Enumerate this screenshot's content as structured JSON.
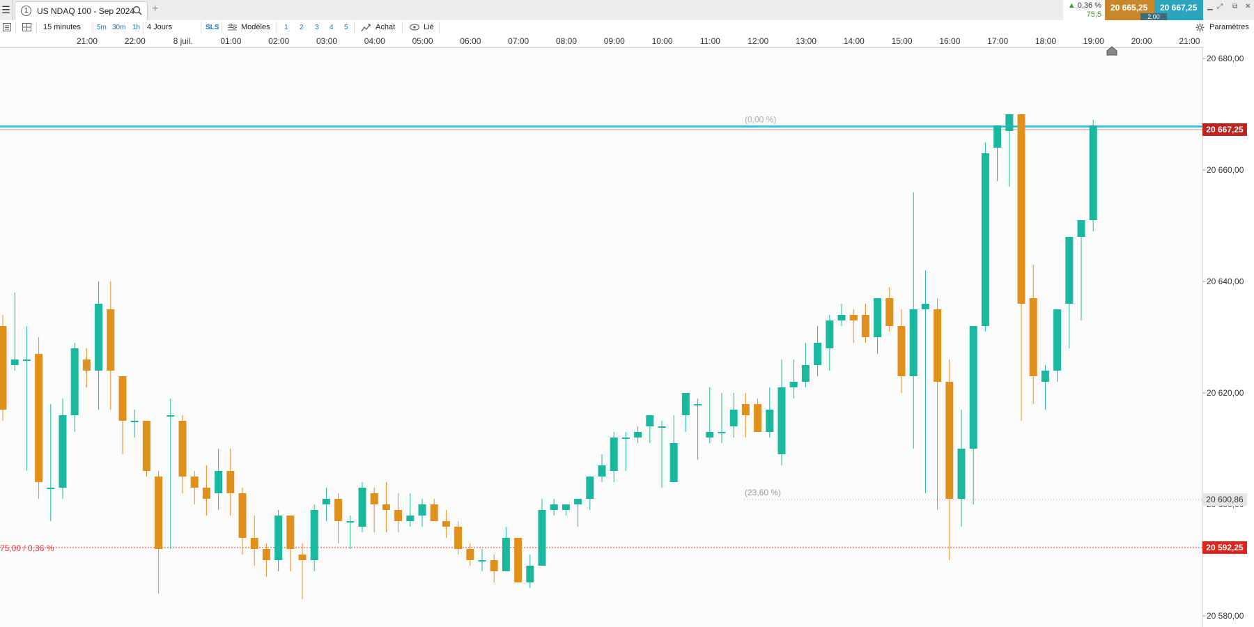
{
  "header": {
    "tab_number": "1",
    "tab_title": "US NDAQ 100 - Sep 2024",
    "change_pct": "0,36 %",
    "change_pts": "75,5",
    "bid": "20 665,25",
    "ask": "20 667,25",
    "spread": "2,00"
  },
  "toolbar": {
    "interval": "15 minutes",
    "btn_5m": "5m",
    "btn_30m": "30m",
    "btn_1h": "1h",
    "range": "4 Jours",
    "sls": "SLS",
    "models": "Modèles",
    "presets": [
      "1",
      "2",
      "3",
      "4",
      "5"
    ],
    "buy": "Achat",
    "linked": "Lié",
    "settings": "Paramètres"
  },
  "colors": {
    "bull": "#1bb8a0",
    "bear": "#e0911d",
    "price_line": "#2ec4e6",
    "last_price_bg": "#c0221d",
    "ref_line": "#e23b3b"
  },
  "chart_data": {
    "type": "candlestick",
    "instrument": "US NDAQ 100 - Sep 2024",
    "interval": "15 minutes",
    "x_ticks": [
      "21:00",
      "22:00",
      "8 juil.",
      "01:00",
      "02:00",
      "03:00",
      "04:00",
      "05:00",
      "06:00",
      "07:00",
      "08:00",
      "09:00",
      "10:00",
      "11:00",
      "12:00",
      "13:00",
      "14:00",
      "15:00",
      "16:00",
      "17:00",
      "18:00",
      "19:00",
      "20:00",
      "21:00"
    ],
    "y_ticks": [
      "20 580,00",
      "20 600,00",
      "20 620,00",
      "20 640,00",
      "20 660,00",
      "20 680,00"
    ],
    "ylim": [
      20578,
      20682
    ],
    "price_axis_position": "right",
    "last_price": "20 667,25",
    "reference_price": "20 592,25",
    "reference_label": "75,00 / 0,36 %",
    "fib_levels": [
      {
        "label": "(0,00 %)",
        "value": 20667.8
      },
      {
        "label": "(23,60 %)",
        "value": 20600.86,
        "value_label": "20 600,86"
      }
    ],
    "candles": [
      [
        20632,
        20634,
        20615,
        20617
      ],
      [
        20625,
        20638,
        20624,
        20626
      ],
      [
        20626,
        20632,
        20606,
        20626
      ],
      [
        20627,
        20630,
        20601,
        20604
      ],
      [
        20603,
        20618,
        20597,
        20603
      ],
      [
        20603,
        20619,
        20601,
        20616
      ],
      [
        20616,
        20629,
        20613,
        20628
      ],
      [
        20626,
        20628,
        20621,
        20624
      ],
      [
        20624,
        20640,
        20617,
        20636
      ],
      [
        20635,
        20640,
        20617,
        20624
      ],
      [
        20623,
        20619,
        20609,
        20615
      ],
      [
        20615,
        20617,
        20612,
        20615
      ],
      [
        20615,
        20615,
        20605,
        20606
      ],
      [
        20605,
        20606,
        20584,
        20592
      ],
      [
        20616,
        20619,
        20592,
        20616
      ],
      [
        20615,
        20616,
        20602,
        20605
      ],
      [
        20605,
        20606,
        20600,
        20603
      ],
      [
        20603,
        20607,
        20598,
        20601
      ],
      [
        20602,
        20610,
        20599,
        20606
      ],
      [
        20606,
        20610,
        20598,
        20602
      ],
      [
        20602,
        20603,
        20591,
        20594
      ],
      [
        20594,
        20598,
        20589,
        20592
      ],
      [
        20592,
        20593,
        20587,
        20590
      ],
      [
        20590,
        20599,
        20588,
        20598
      ],
      [
        20598,
        20598,
        20588,
        20592
      ],
      [
        20591,
        20593,
        20583,
        20590
      ],
      [
        20590,
        20600,
        20588,
        20599
      ],
      [
        20600,
        20603,
        20597,
        20601
      ],
      [
        20601,
        20602,
        20593,
        20597
      ],
      [
        20597,
        20598,
        20592,
        20597
      ],
      [
        20596,
        20604,
        20595,
        20603
      ],
      [
        20602,
        20603,
        20595,
        20600
      ],
      [
        20600,
        20604,
        20595,
        20599
      ],
      [
        20599,
        20602,
        20595,
        20597
      ],
      [
        20597,
        20602,
        20596,
        20598
      ],
      [
        20598,
        20601,
        20596,
        20600
      ],
      [
        20600,
        20601,
        20597,
        20597
      ],
      [
        20597,
        20599,
        20594,
        20596
      ],
      [
        20596,
        20597,
        20591,
        20592
      ],
      [
        20592,
        20593,
        20589,
        20590
      ],
      [
        20590,
        20592,
        20588,
        20590
      ],
      [
        20590,
        20591,
        20586,
        20588
      ],
      [
        20588,
        20596,
        20588,
        20594
      ],
      [
        20594,
        20594,
        20586,
        20586
      ],
      [
        20586,
        20591,
        20585,
        20589
      ],
      [
        20589,
        20601,
        20589,
        20599
      ],
      [
        20599,
        20601,
        20598,
        20600
      ],
      [
        20599,
        20600,
        20598,
        20600
      ],
      [
        20600,
        20601,
        20596,
        20601
      ],
      [
        20601,
        20605,
        20599,
        20605
      ],
      [
        20605,
        20609,
        20604,
        20607
      ],
      [
        20606,
        20613,
        20604,
        20612
      ],
      [
        20612,
        20613,
        20606,
        20612
      ],
      [
        20612,
        20614,
        20611,
        20613
      ],
      [
        20614,
        20616,
        20611,
        20616
      ],
      [
        20614,
        20615,
        20603,
        20614
      ],
      [
        20604,
        20616,
        20604,
        20611
      ],
      [
        20616,
        20619,
        20613,
        20620
      ],
      [
        20618,
        20619,
        20608,
        20618
      ],
      [
        20612,
        20621,
        20611,
        20613
      ],
      [
        20613,
        20620,
        20611,
        20613
      ],
      [
        20614,
        20620,
        20612,
        20617
      ],
      [
        20618,
        20620,
        20612,
        20616
      ],
      [
        20618,
        20619,
        20613,
        20613
      ],
      [
        20613,
        20621,
        20612,
        20617
      ],
      [
        20609,
        20626,
        20607,
        20621
      ],
      [
        20621,
        20626,
        20619,
        20622
      ],
      [
        20622,
        20629,
        20621,
        20625
      ],
      [
        20625,
        20632,
        20623,
        20629
      ],
      [
        20628,
        20634,
        20624,
        20633
      ],
      [
        20633,
        20636,
        20632,
        20634
      ],
      [
        20634,
        20635,
        20629,
        20633
      ],
      [
        20634,
        20636,
        20629,
        20630
      ],
      [
        20630,
        20637,
        20627,
        20637
      ],
      [
        20637,
        20639,
        20631,
        20632
      ],
      [
        20632,
        20635,
        20620,
        20623
      ],
      [
        20623,
        20656,
        20610,
        20635
      ],
      [
        20635,
        20642,
        20602,
        20636
      ],
      [
        20635,
        20637,
        20599,
        20622
      ],
      [
        20622,
        20626,
        20590,
        20601
      ],
      [
        20601,
        20617,
        20596,
        20610
      ],
      [
        20610,
        20632,
        20600,
        20632
      ],
      [
        20632,
        20665,
        20631,
        20663
      ],
      [
        20664,
        20667,
        20658,
        20668
      ],
      [
        20667,
        20670,
        20657,
        20670
      ],
      [
        20670,
        20669,
        20615,
        20636
      ],
      [
        20637,
        20643,
        20618,
        20623
      ],
      [
        20622,
        20625,
        20617,
        20624
      ],
      [
        20624,
        20632,
        20622,
        20635
      ],
      [
        20636,
        20640,
        20628,
        20648
      ],
      [
        20648,
        20650,
        20633,
        20651
      ],
      [
        20651,
        20669,
        20649,
        20668
      ]
    ]
  }
}
